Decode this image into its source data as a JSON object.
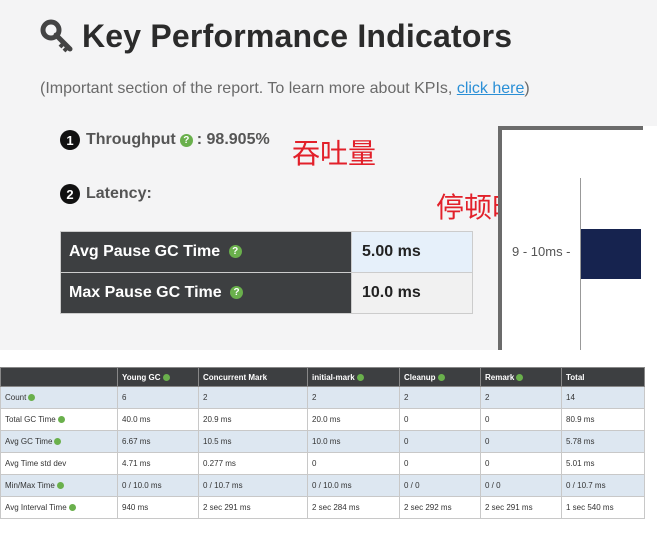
{
  "kpi": {
    "title": "Key Performance Indicators",
    "subtitle_prefix": "(Important section of the report. To learn more about KPIs, ",
    "subtitle_link": "click here",
    "subtitle_suffix": ")",
    "throughput": {
      "number": "1",
      "label": "Throughput",
      "value": ": 98.905%",
      "annotation": "吞吐量"
    },
    "latency": {
      "number": "2",
      "label": "Latency:",
      "annotation": "停顿时间"
    },
    "pause_rows": [
      {
        "label": "Avg Pause GC Time",
        "value": "5.00 ms"
      },
      {
        "label": "Max Pause GC Time",
        "value": "10.0 ms"
      }
    ],
    "chart_tick": "9 - 10ms -",
    "icon": "key-icon"
  },
  "gc_table": {
    "headers": [
      "",
      "Young GC",
      "Concurrent Mark",
      "initial-mark",
      "Cleanup",
      "Remark",
      "Total"
    ],
    "header_help": [
      false,
      true,
      false,
      true,
      true,
      true,
      false
    ],
    "rows": [
      {
        "label": "Count",
        "cells": [
          "6",
          "2",
          "2",
          "2",
          "2",
          "14"
        ]
      },
      {
        "label": "Total GC Time",
        "cells": [
          "40.0 ms",
          "20.9 ms",
          "20.0 ms",
          "0",
          "0",
          "80.9 ms"
        ]
      },
      {
        "label": "Avg GC Time",
        "cells": [
          "6.67 ms",
          "10.5 ms",
          "10.0 ms",
          "0",
          "0",
          "5.78 ms"
        ]
      },
      {
        "label": "Avg Time std dev",
        "cells": [
          "4.71 ms",
          "0.277 ms",
          "0",
          "0",
          "0",
          "5.01 ms"
        ]
      },
      {
        "label": "Min/Max Time",
        "cells": [
          "0 / 10.0 ms",
          "0 / 10.7 ms",
          "0 / 10.0 ms",
          "0 / 0",
          "0 / 0",
          "0 / 10.7 ms"
        ]
      },
      {
        "label": "Avg Interval Time",
        "cells": [
          "940 ms",
          "2 sec 291 ms",
          "2 sec 284 ms",
          "2 sec 292 ms",
          "2 sec 291 ms",
          "1 sec 540 ms"
        ]
      }
    ],
    "row_help": [
      true,
      true,
      true,
      false,
      true,
      true
    ]
  }
}
